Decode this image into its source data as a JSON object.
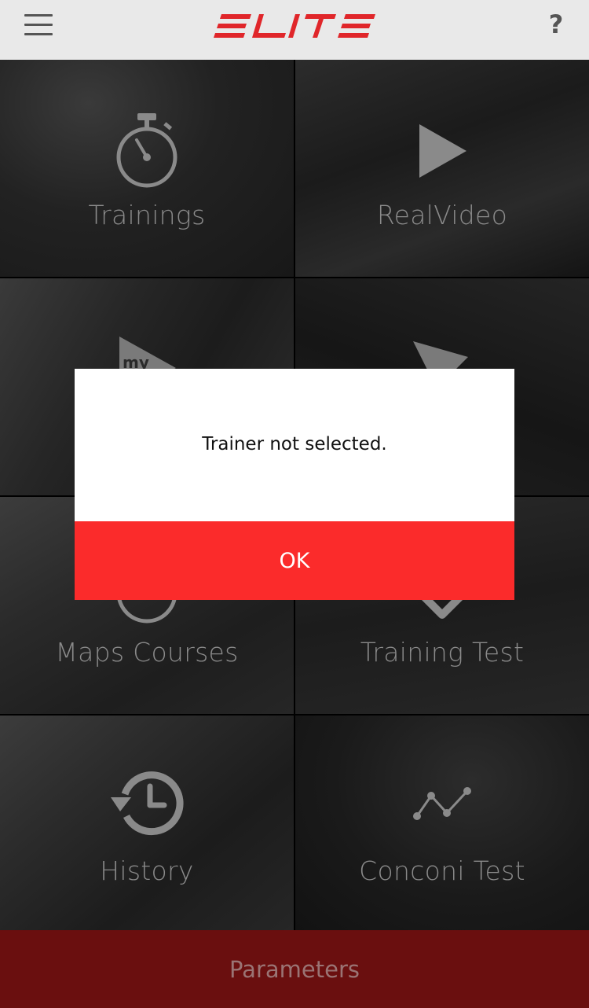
{
  "header": {
    "logo_text": "ELITE",
    "menu_icon": "hamburger-menu-icon",
    "help_label": "?"
  },
  "tiles": [
    {
      "label": "Trainings",
      "icon": "stopwatch-icon"
    },
    {
      "label": "RealVideo",
      "icon": "play-icon"
    },
    {
      "label": "",
      "icon": "my-video-icon"
    },
    {
      "label": "",
      "icon": "navigation-arrow-icon"
    },
    {
      "label": "Maps Courses",
      "icon": "map-circle-icon"
    },
    {
      "label": "Training Test",
      "icon": "checkmark-icon"
    },
    {
      "label": "History",
      "icon": "history-clock-icon"
    },
    {
      "label": "Conconi Test",
      "icon": "line-graph-icon"
    }
  ],
  "bottom_bar": {
    "label": "Parameters"
  },
  "dialog": {
    "message": "Trainer not selected.",
    "ok_label": "OK"
  },
  "colors": {
    "brand_red": "#e0262a",
    "dialog_button": "#fb2b2b",
    "bottom_bar": "#6a0f0f"
  }
}
